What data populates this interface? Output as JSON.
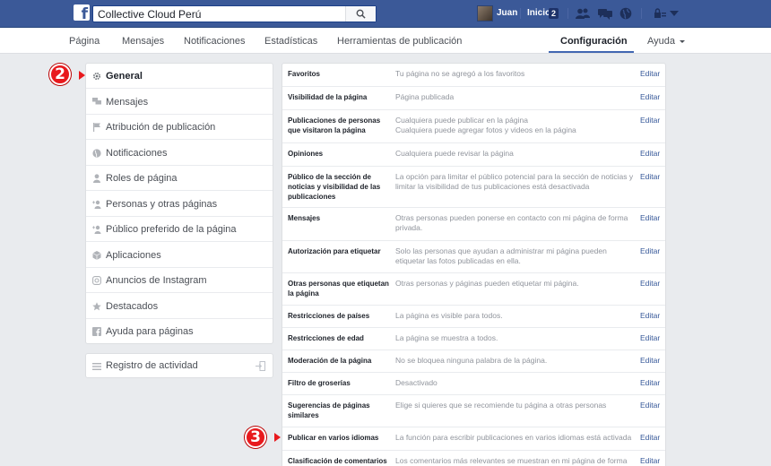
{
  "topbar": {
    "search_value": "Collective Cloud Perú",
    "user_name": "Juan",
    "home_label": "Inicio",
    "home_count": "2"
  },
  "nav": {
    "items": [
      "Página",
      "Mensajes",
      "Notificaciones",
      "Estadísticas",
      "Herramientas de publicación",
      "Configuración",
      "Ayuda"
    ],
    "active": "Configuración"
  },
  "sidebar": {
    "items": [
      {
        "label": "General",
        "icon": "gear-icon"
      },
      {
        "label": "Mensajes",
        "icon": "chat-bubbles-icon"
      },
      {
        "label": "Atribución de publicación",
        "icon": "flag-icon"
      },
      {
        "label": "Notificaciones",
        "icon": "globe-icon"
      },
      {
        "label": "Roles de página",
        "icon": "person-icon"
      },
      {
        "label": "Personas y otras páginas",
        "icon": "person-plus-icon"
      },
      {
        "label": "Público preferido de la página",
        "icon": "person-plus-icon"
      },
      {
        "label": "Aplicaciones",
        "icon": "cube-icon"
      },
      {
        "label": "Anuncios de Instagram",
        "icon": "instagram-icon"
      },
      {
        "label": "Destacados",
        "icon": "star-icon"
      },
      {
        "label": "Ayuda para páginas",
        "icon": "facebook-icon"
      }
    ],
    "activity_label": "Registro de actividad"
  },
  "markers": {
    "general": "2",
    "languages": "3"
  },
  "settings": {
    "edit_label": "Editar",
    "rows": [
      {
        "label": "Favoritos",
        "value": "Tu página no se agregó a los favoritos"
      },
      {
        "label": "Visibilidad de la página",
        "value": "Página publicada"
      },
      {
        "label": "Publicaciones de personas que visitaron la página",
        "value": "Cualquiera puede publicar en la página\nCualquiera puede agregar fotos y videos en la página"
      },
      {
        "label": "Opiniones",
        "value": "Cualquiera puede revisar la página"
      },
      {
        "label": "Público de la sección de noticias y visibilidad de las publicaciones",
        "value": "La opción para limitar el público potencial para la sección de noticias y limitar la visibilidad de tus publicaciones está desactivada"
      },
      {
        "label": "Mensajes",
        "value": "Otras personas pueden ponerse en contacto con mi página de forma privada."
      },
      {
        "label": "Autorización para etiquetar",
        "value": "Solo las personas que ayudan a administrar mi página pueden etiquetar las fotos publicadas en ella."
      },
      {
        "label": "Otras personas que etiquetan la página",
        "value": "Otras personas y páginas pueden etiquetar mi página."
      },
      {
        "label": "Restricciones de países",
        "value": "La página es visible para todos."
      },
      {
        "label": "Restricciones de edad",
        "value": "La página se muestra a todos."
      },
      {
        "label": "Moderación de la página",
        "value": "No se bloquea ninguna palabra de la página."
      },
      {
        "label": "Filtro de groserías",
        "value": "Desactivado"
      },
      {
        "label": "Sugerencias de páginas similares",
        "value": "Elige si quieres que se recomiende tu página a otras personas"
      },
      {
        "label": "Publicar en varios idiomas",
        "value": "La función para escribir publicaciones en varios idiomas está activada"
      },
      {
        "label": "Clasificación de comentarios",
        "value": "Los comentarios más relevantes se muestran en mi página de forma"
      }
    ]
  },
  "colors": {
    "brand": "#3b5998",
    "link": "#365899",
    "marker": "#e8191d"
  }
}
